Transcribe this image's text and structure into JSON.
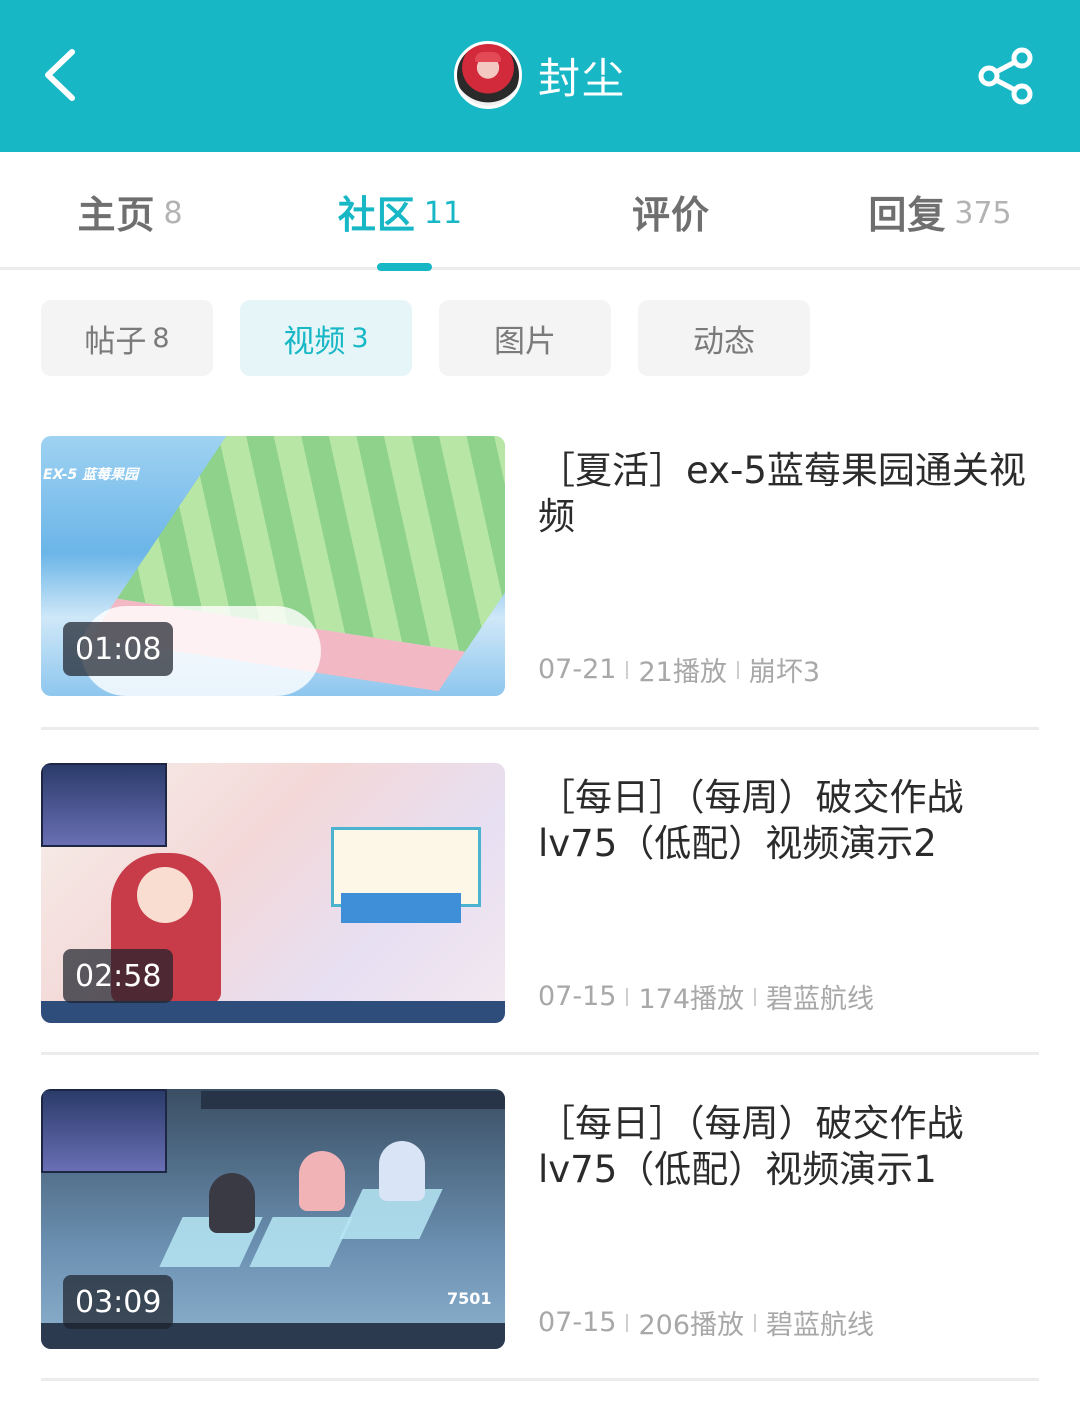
{
  "header": {
    "title": "封尘"
  },
  "tabs": [
    {
      "label": "主页",
      "count": "8"
    },
    {
      "label": "社区",
      "count": "11"
    },
    {
      "label": "评价",
      "count": ""
    },
    {
      "label": "回复",
      "count": "375"
    }
  ],
  "active_tab": "社区",
  "subtabs": [
    {
      "label": "帖子",
      "count": "8"
    },
    {
      "label": "视频",
      "count": "3"
    },
    {
      "label": "图片",
      "count": ""
    },
    {
      "label": "动态",
      "count": ""
    }
  ],
  "active_subtab": "视频",
  "videos": [
    {
      "title": "［夏活］ex-5蓝莓果园通关视频",
      "duration": "01:08",
      "date": "07-21",
      "plays": "21播放",
      "game": "崩坏3",
      "thumb_text": "EX-5 蓝莓果园"
    },
    {
      "title": "［每日］（每周）破交作战lv75（低配）视频演示2",
      "duration": "02:58",
      "date": "07-15",
      "plays": "174播放",
      "game": "碧蓝航线"
    },
    {
      "title": "［每日］（每周）破交作战lv75（低配）视频演示1",
      "duration": "03:09",
      "date": "07-15",
      "plays": "206播放",
      "game": "碧蓝航线",
      "thumb_number": "7501"
    }
  ],
  "colors": {
    "accent": "#17b7c6",
    "active_chip_bg": "#e6f6f8"
  },
  "icons": {
    "back": "chevron-left-icon",
    "share": "share-icon"
  }
}
